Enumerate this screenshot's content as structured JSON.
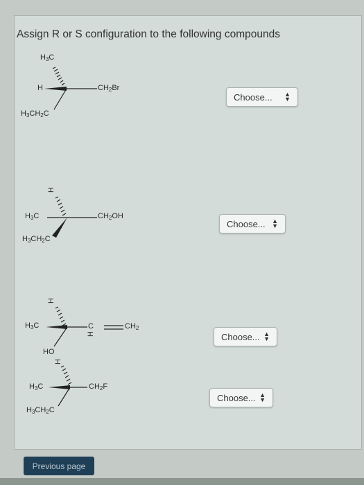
{
  "instructions": "Assign R or S configuration to the following compounds",
  "compounds": [
    {
      "top": [
        "H",
        "3",
        "C"
      ],
      "left": "H",
      "right": [
        "CH",
        "2",
        "Br"
      ],
      "bottom": [
        "H",
        "3",
        "CH",
        "2",
        "C"
      ],
      "choice": "Choose..."
    },
    {
      "top": "H",
      "left": [
        "H",
        "3",
        "C"
      ],
      "right": [
        "CH",
        "2",
        "OH"
      ],
      "bottom": [
        "H",
        "3",
        "CH",
        "2",
        "C"
      ],
      "choice": "Choose..."
    },
    {
      "top": "H",
      "left": [
        "H",
        "3",
        "C"
      ],
      "right_c": "C",
      "right_h": "H",
      "right_end": [
        "CH",
        "2"
      ],
      "bottom": "HO",
      "choice": "Choose..."
    },
    {
      "top": "H",
      "left": [
        "H",
        "3",
        "C"
      ],
      "right": [
        "CH",
        "2",
        "F"
      ],
      "bottom": [
        "H",
        "3",
        "CH",
        "2",
        "C"
      ],
      "choice": "Choose..."
    }
  ],
  "nav": {
    "previous_label": "Previous page"
  },
  "icons": {
    "select_arrow": "up-down-arrows-icon"
  }
}
